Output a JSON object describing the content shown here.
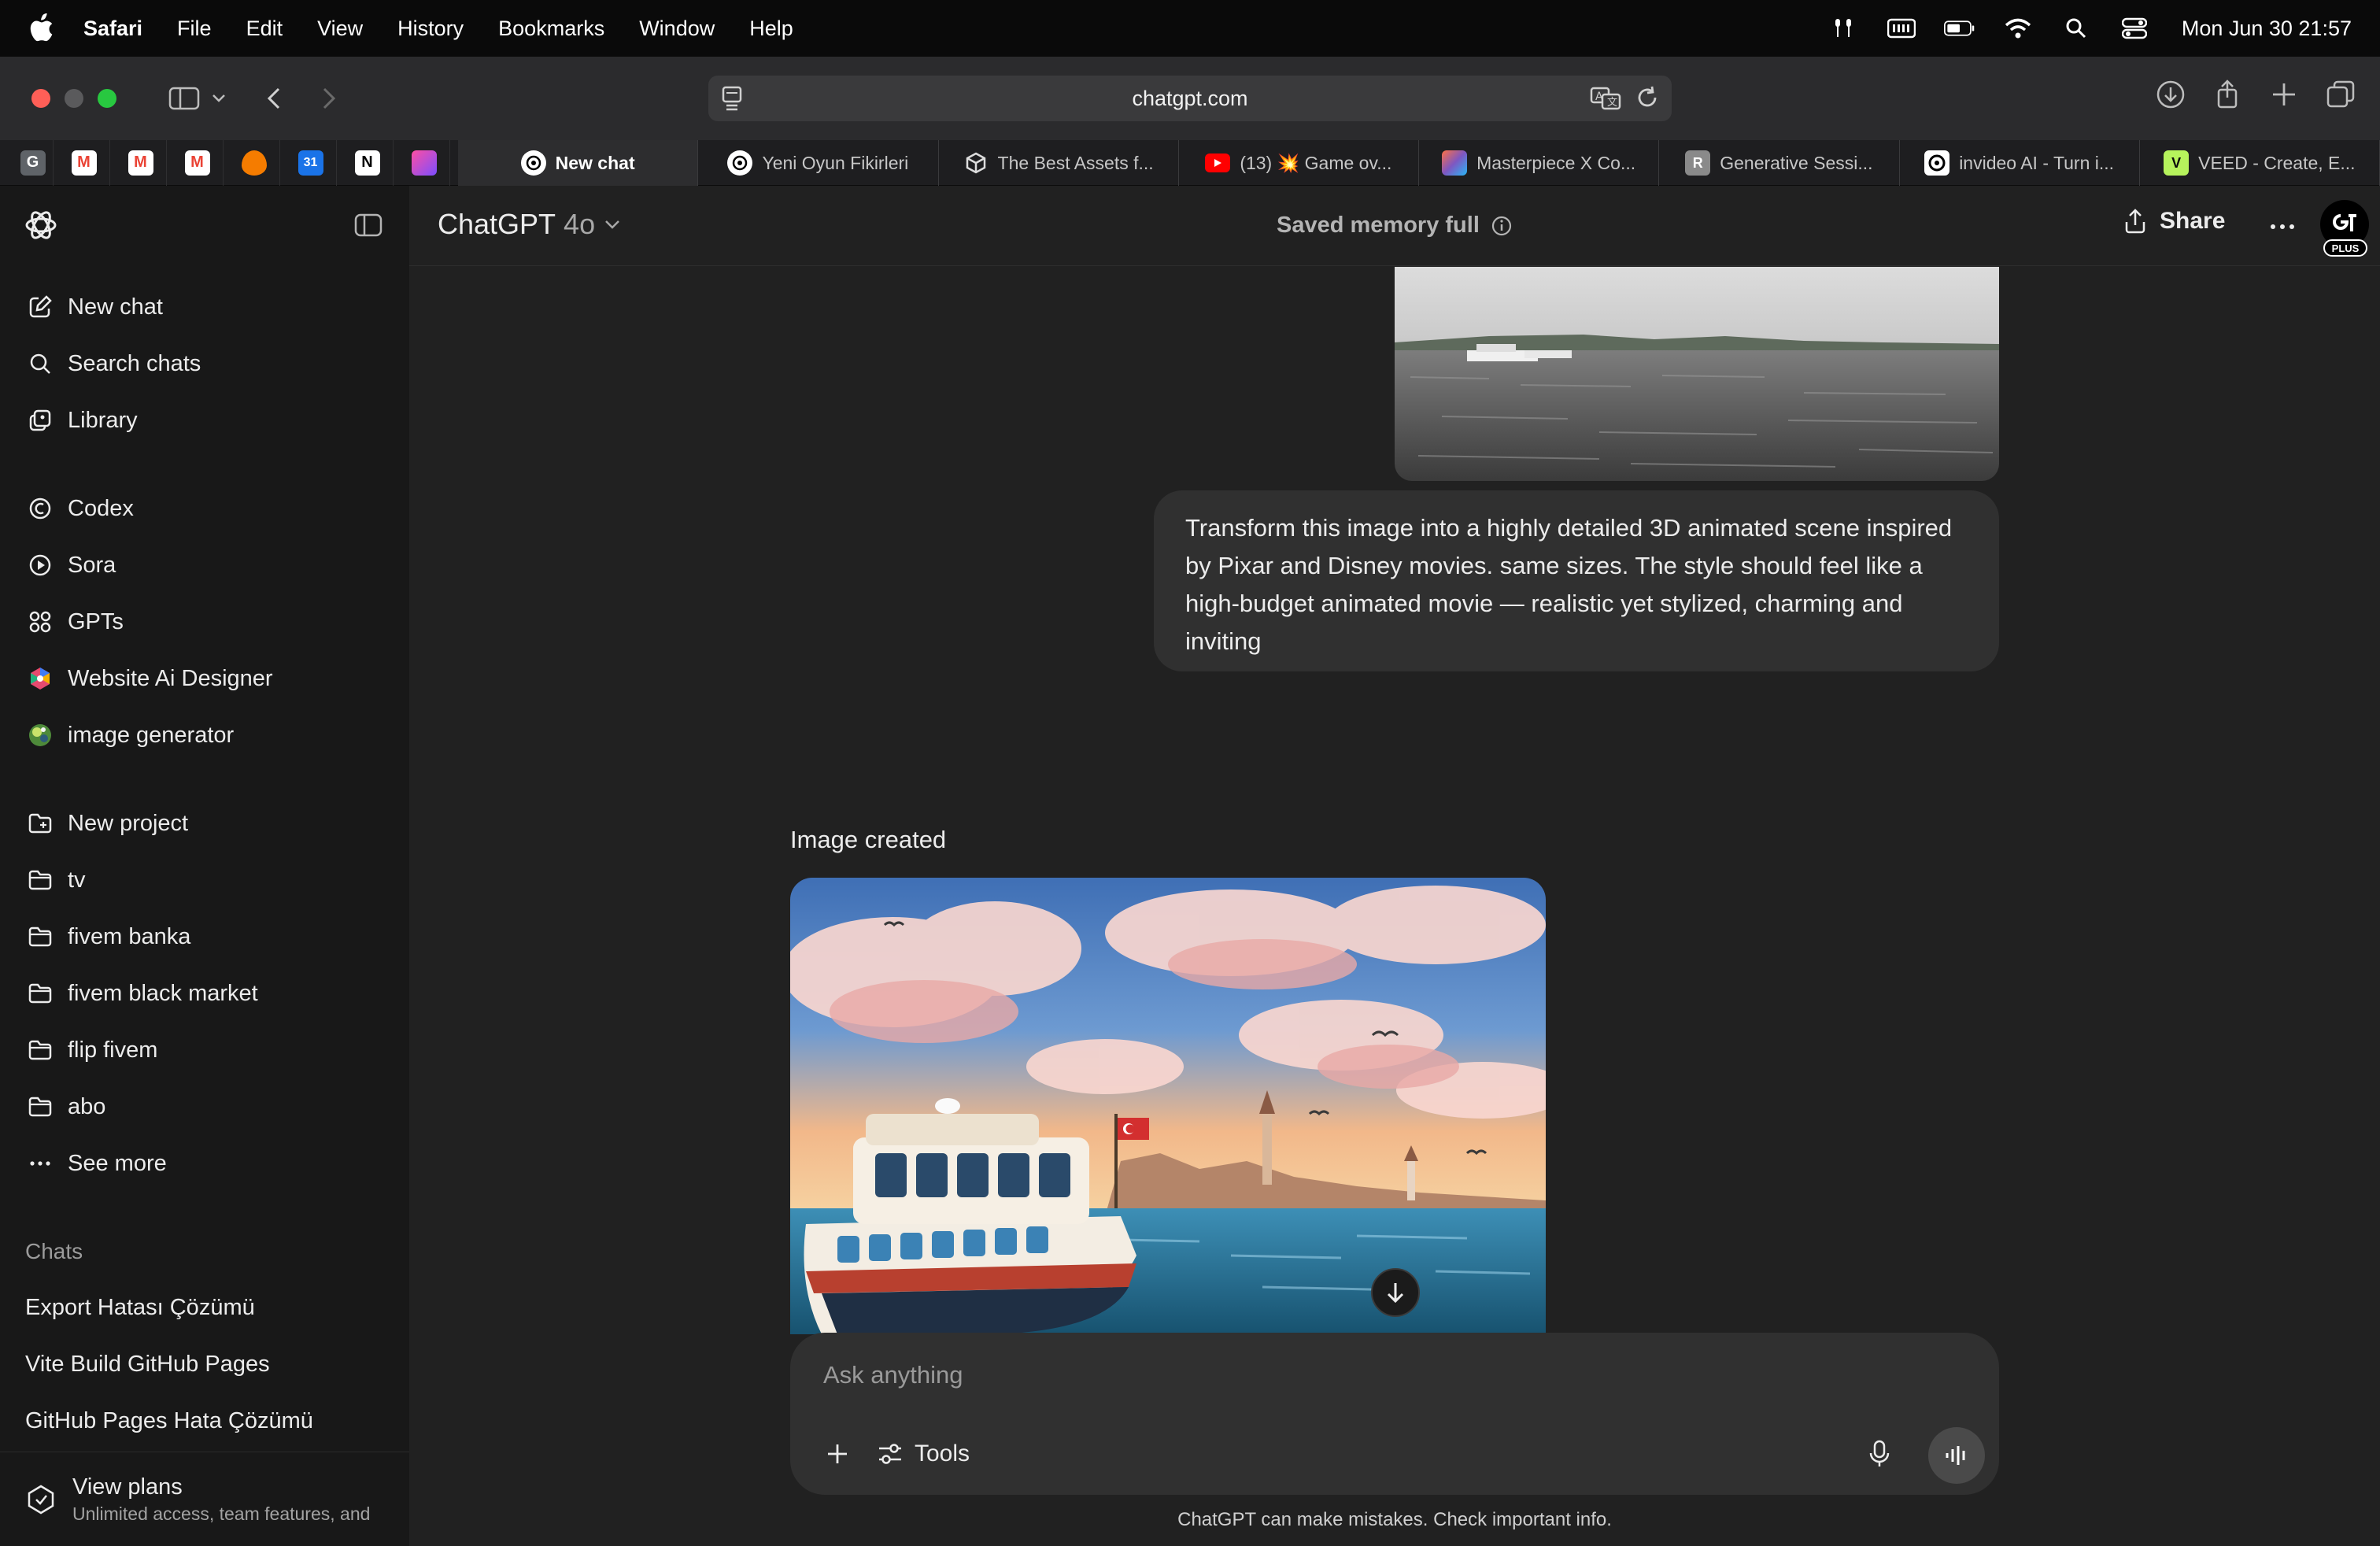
{
  "menubar": {
    "app": "Safari",
    "items": [
      "File",
      "Edit",
      "View",
      "History",
      "Bookmarks",
      "Window",
      "Help"
    ],
    "clock": "Mon Jun 30  21:57"
  },
  "browser": {
    "url": "chatgpt.com",
    "tabs": [
      {
        "label": "New chat",
        "active": true
      },
      {
        "label": "Yeni Oyun Fikirleri"
      },
      {
        "label": "The Best Assets f..."
      },
      {
        "label": "(13) 💥 Game ov..."
      },
      {
        "label": "Masterpiece X Co..."
      },
      {
        "label": "Generative Sessi..."
      },
      {
        "label": "invideo AI - Turn i..."
      },
      {
        "label": "VEED - Create, E..."
      }
    ],
    "pinned_labels": [
      "G",
      "M",
      "M",
      "M",
      "",
      "31",
      "N",
      ""
    ]
  },
  "sidebar": {
    "nav": [
      {
        "label": "New chat",
        "icon": "new-chat-icon"
      },
      {
        "label": "Search chats",
        "icon": "search-icon"
      },
      {
        "label": "Library",
        "icon": "library-icon"
      }
    ],
    "apps": [
      {
        "label": "Codex",
        "icon": "codex-icon"
      },
      {
        "label": "Sora",
        "icon": "sora-icon"
      },
      {
        "label": "GPTs",
        "icon": "gpts-icon"
      },
      {
        "label": "Website Ai Designer",
        "icon": "gpt-avatar-icon"
      },
      {
        "label": "image generator",
        "icon": "gpt-avatar-icon"
      }
    ],
    "projects": [
      {
        "label": "New project",
        "icon": "new-folder-icon"
      },
      {
        "label": "tv",
        "icon": "folder-icon"
      },
      {
        "label": "fivem banka",
        "icon": "folder-icon"
      },
      {
        "label": "fivem black market",
        "icon": "folder-icon"
      },
      {
        "label": "flip fivem",
        "icon": "folder-icon"
      },
      {
        "label": "abo",
        "icon": "folder-icon"
      },
      {
        "label": "See more",
        "icon": "more-icon"
      }
    ],
    "chats_heading": "Chats",
    "chats": [
      "Export Hatası Çözümü",
      "Vite Build GitHub Pages",
      "GitHub Pages Hata Çözümü"
    ],
    "plans": {
      "title": "View plans",
      "subtitle": "Unlimited access, team features, and"
    }
  },
  "header": {
    "model_name": "ChatGPT",
    "model_version": "4o",
    "memory_status": "Saved memory full",
    "share_label": "Share",
    "avatar_plan": "PLUS"
  },
  "conversation": {
    "user_message": "Transform this image into a highly detailed 3D animated scene inspired by Pixar and Disney movies. same sizes.  The style should feel like a high-budget animated movie — realistic yet stylized, charming and inviting",
    "assistant_status": "Image created"
  },
  "composer": {
    "placeholder": "Ask anything",
    "tools_label": "Tools",
    "disclaimer": "ChatGPT can make mistakes. Check important info."
  },
  "colors": {
    "sidebar_bg": "#181818",
    "main_bg": "#212121",
    "bubble_bg": "#303030",
    "text": "#ececec"
  }
}
